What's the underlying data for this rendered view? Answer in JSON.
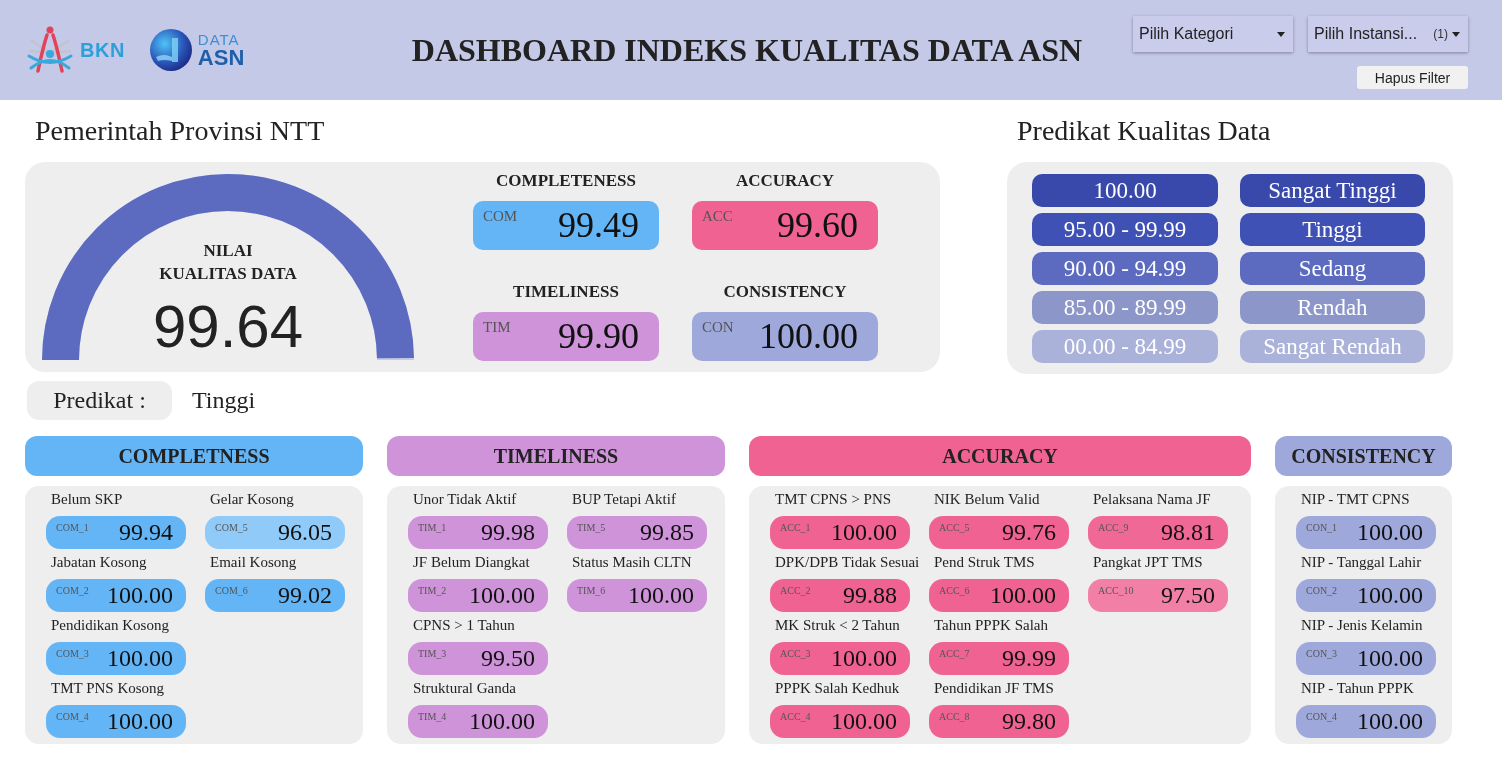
{
  "header": {
    "logos": [
      {
        "kind": "figure",
        "text": "BKN"
      },
      {
        "kind": "globe",
        "lines": [
          "DATA",
          "ASN"
        ]
      }
    ],
    "title": "DASHBOARD INDEKS KUALITAS DATA ASN",
    "filters": [
      {
        "label": "Pilih Kategori"
      },
      {
        "label": "Pilih Instansi...",
        "badge": "(1)"
      }
    ],
    "clear_button": "Hapus Filter"
  },
  "overview": {
    "title": "Pemerintah Provinsi NTT",
    "gauge": {
      "caption": "NILAI\nKUALITAS DATA",
      "value": "99.64",
      "level": 0.9964
    },
    "metrics": [
      {
        "title": "COMPLETENESS",
        "code": "COM",
        "value": "99.49",
        "color": "#64b5f6"
      },
      {
        "title": "ACCURACY",
        "code": "ACC",
        "value": "99.60",
        "color": "#f06292"
      },
      {
        "title": "TIMELINESS",
        "code": "TIM",
        "value": "99.90",
        "color": "#ce93d8"
      },
      {
        "title": "CONSISTENCY",
        "code": "CON",
        "value": "100.00",
        "color": "#9fa8da"
      }
    ],
    "predicate": {
      "label": "Predikat :",
      "value": "Tinggi"
    }
  },
  "legend": {
    "title": "Predikat Kualitas Data",
    "rows": [
      {
        "range": "100.00",
        "label": "Sangat Tinggi",
        "color": "#3949ab"
      },
      {
        "range": "95.00 - 99.99",
        "label": "Tinggi",
        "color": "#3f51b5"
      },
      {
        "range": "90.00 - 94.99",
        "label": "Sedang",
        "color": "#5c6bc0"
      },
      {
        "range": "85.00 - 89.99",
        "label": "Rendah",
        "color": "#8c96c9"
      },
      {
        "range": "00.00 - 84.99",
        "label": "Sangat Rendah",
        "color": "#aab2d9"
      }
    ]
  },
  "sections": [
    {
      "title": "COMPLETNESS",
      "color": "#64b5f6",
      "items": [
        {
          "label": "Belum SKP",
          "code": "COM_1",
          "value": "99.94",
          "color": "#64b5f6"
        },
        {
          "label": "Jabatan Kosong",
          "code": "COM_2",
          "value": "100.00",
          "color": "#64b5f6"
        },
        {
          "label": "Pendidikan Kosong",
          "code": "COM_3",
          "value": "100.00",
          "color": "#64b5f6"
        },
        {
          "label": "TMT PNS Kosong",
          "code": "COM_4",
          "value": "100.00",
          "color": "#64b5f6"
        },
        {
          "label": "Gelar Kosong",
          "code": "COM_5",
          "value": "96.05",
          "color": "#90caf9"
        },
        {
          "label": "Email Kosong",
          "code": "COM_6",
          "value": "99.02",
          "color": "#64b5f6"
        }
      ]
    },
    {
      "title": "TIMELINESS",
      "color": "#ce93d8",
      "items": [
        {
          "label": "Unor Tidak Aktif",
          "code": "TIM_1",
          "value": "99.98",
          "color": "#ce93d8"
        },
        {
          "label": "JF Belum Diangkat",
          "code": "TIM_2",
          "value": "100.00",
          "color": "#ce93d8"
        },
        {
          "label": "CPNS > 1 Tahun",
          "code": "TIM_3",
          "value": "99.50",
          "color": "#ce93d8"
        },
        {
          "label": "Struktural Ganda",
          "code": "TIM_4",
          "value": "100.00",
          "color": "#ce93d8"
        },
        {
          "label": "BUP Tetapi Aktif",
          "code": "TIM_5",
          "value": "99.85",
          "color": "#ce93d8"
        },
        {
          "label": "Status Masih CLTN",
          "code": "TIM_6",
          "value": "100.00",
          "color": "#ce93d8"
        }
      ]
    },
    {
      "title": "ACCURACY",
      "color": "#f06292",
      "items": [
        {
          "label": "TMT CPNS > PNS",
          "code": "ACC_1",
          "value": "100.00",
          "color": "#f06292"
        },
        {
          "label": "DPK/DPB Tidak Sesuai",
          "code": "ACC_2",
          "value": "99.88",
          "color": "#f06292"
        },
        {
          "label": "MK Struk < 2 Tahun",
          "code": "ACC_3",
          "value": "100.00",
          "color": "#f06292"
        },
        {
          "label": "PPPK Salah Kedhuk",
          "code": "ACC_4",
          "value": "100.00",
          "color": "#f06292"
        },
        {
          "label": "NIK Belum Valid",
          "code": "ACC_5",
          "value": "99.76",
          "color": "#f06292"
        },
        {
          "label": "Pend Struk TMS",
          "code": "ACC_6",
          "value": "100.00",
          "color": "#f06292"
        },
        {
          "label": "Tahun PPPK Salah",
          "code": "ACC_7",
          "value": "99.99",
          "color": "#f06292"
        },
        {
          "label": "Pendidikan JF TMS",
          "code": "ACC_8",
          "value": "99.80",
          "color": "#f06292"
        },
        {
          "label": "Pelaksana Nama JF",
          "code": "ACC_9",
          "value": "98.81",
          "color": "#f06896"
        },
        {
          "label": "Pangkat JPT TMS",
          "code": "ACC_10",
          "value": "97.50",
          "color": "#f27fa6"
        }
      ]
    },
    {
      "title": "CONSISTENCY",
      "color": "#9fa8da",
      "items": [
        {
          "label": "NIP - TMT CPNS",
          "code": "CON_1",
          "value": "100.00",
          "color": "#9fa8da"
        },
        {
          "label": "NIP - Tanggal Lahir",
          "code": "CON_2",
          "value": "100.00",
          "color": "#9fa8da"
        },
        {
          "label": "NIP - Jenis Kelamin",
          "code": "CON_3",
          "value": "100.00",
          "color": "#9fa8da"
        },
        {
          "label": "NIP - Tahun PPPK",
          "code": "CON_4",
          "value": "100.00",
          "color": "#9fa8da"
        }
      ]
    }
  ]
}
